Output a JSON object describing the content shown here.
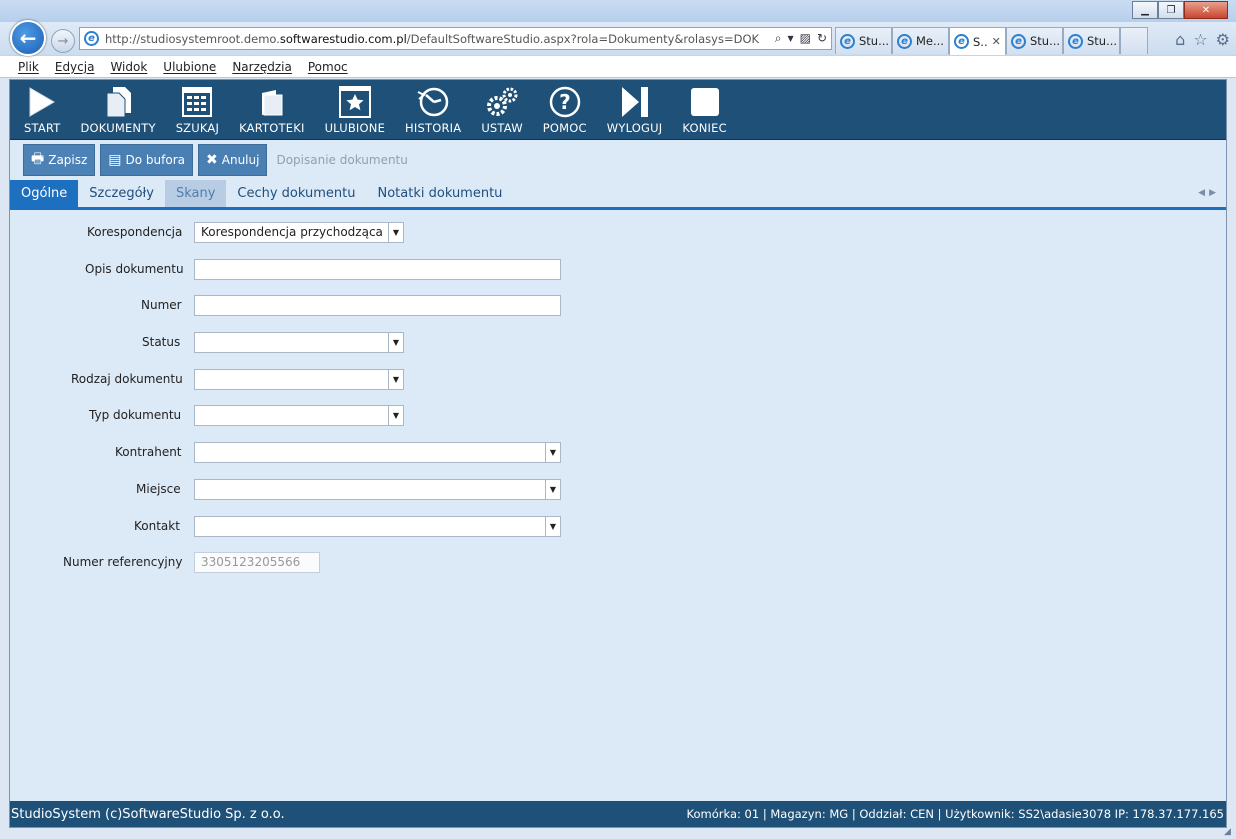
{
  "browser": {
    "url_prefix": "http://studiosystemroot.demo.",
    "url_domain": "softwarestudio.com.pl",
    "url_suffix": "/DefaultSoftwareStudio.aspx?rola=Dokumenty&rolasys=DOK",
    "tabs": [
      {
        "label": "Stu...",
        "active": false
      },
      {
        "label": "Me...",
        "active": false
      },
      {
        "label": "S..",
        "active": true
      },
      {
        "label": "Stu...",
        "active": false
      },
      {
        "label": "Stu...",
        "active": false
      }
    ]
  },
  "menu": [
    "Plik",
    "Edycja",
    "Widok",
    "Ulubione",
    "Narzędzia",
    "Pomoc"
  ],
  "toolbar": [
    {
      "label": "START",
      "icon": "play-icon"
    },
    {
      "label": "DOKUMENTY",
      "icon": "documents-icon"
    },
    {
      "label": "SZUKAJ",
      "icon": "search-list-icon"
    },
    {
      "label": "KARTOTEKI",
      "icon": "folder-icon"
    },
    {
      "label": "ULUBIONE",
      "icon": "star-icon"
    },
    {
      "label": "HISTORIA",
      "icon": "history-icon"
    },
    {
      "label": "USTAW",
      "icon": "gears-icon"
    },
    {
      "label": "POMOC",
      "icon": "help-icon"
    },
    {
      "label": "WYLOGUJ",
      "icon": "logout-icon"
    },
    {
      "label": "KONIEC",
      "icon": "exit-icon"
    }
  ],
  "actions": {
    "save": "Zapisz",
    "buffer": "Do bufora",
    "cancel": "Anuluj",
    "crumb": "Dopisanie dokumentu"
  },
  "form_tabs": [
    {
      "label": "Ogólne",
      "state": "active"
    },
    {
      "label": "Szczegóły",
      "state": "normal"
    },
    {
      "label": "Skany",
      "state": "hover"
    },
    {
      "label": "Cechy dokumentu",
      "state": "normal"
    },
    {
      "label": "Notatki dokumentu",
      "state": "normal"
    }
  ],
  "fields": {
    "korespondencja": {
      "label": "Korespondencja",
      "value": "Korespondencja przychodząca"
    },
    "opis": {
      "label": "Opis dokumentu",
      "value": ""
    },
    "numer": {
      "label": "Numer",
      "value": ""
    },
    "status": {
      "label": "Status",
      "value": ""
    },
    "rodzaj": {
      "label": "Rodzaj dokumentu",
      "value": ""
    },
    "typ": {
      "label": "Typ dokumentu",
      "value": ""
    },
    "kontrahent": {
      "label": "Kontrahent",
      "value": ""
    },
    "miejsce": {
      "label": "Miejsce",
      "value": ""
    },
    "kontakt": {
      "label": "Kontakt",
      "value": ""
    },
    "numer_ref": {
      "label": "Numer referencyjny",
      "value": "3305123205566"
    }
  },
  "status": {
    "left": "StudioSystem (c)SoftwareStudio Sp. z o.o.",
    "right": "Komórka: 01 | Magazyn: MG | Oddział: CEN | Użytkownik: SS2\\adasie3078 IP: 178.37.177.165"
  }
}
